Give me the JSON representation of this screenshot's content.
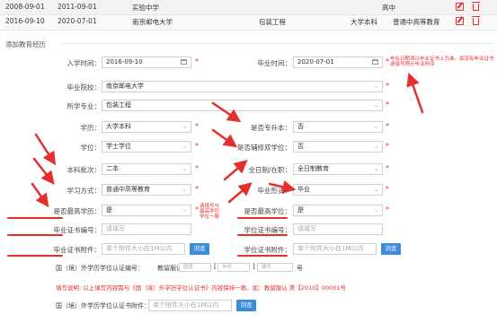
{
  "table": {
    "rows": [
      {
        "start": "2008-09-01",
        "end": "2011-09-01",
        "school": "实验中学",
        "major": "",
        "level": "高中",
        "mode": ""
      },
      {
        "start": "2016-09-10",
        "end": "2020-07-01",
        "school": "南京邮电大学",
        "major": "包装工程",
        "level": "大学本科",
        "mode": "普通中高等教育"
      }
    ]
  },
  "section_title": "添加教育经历",
  "form": {
    "enroll_label": "入学时间：",
    "enroll_value": "2016-09-10",
    "graduate_label": "毕业时间：",
    "graduate_value": "2020-07-01",
    "school_label": "毕业院校：",
    "school_value": "南京邮电大学",
    "major_label": "所学专业：",
    "major_value": "包装工程",
    "edu_label": "学历：",
    "edu_value": "大学本科",
    "upgrade_label": "是否专升本：",
    "upgrade_value": "否",
    "degree_label": "学位：",
    "degree_value": "学士学位",
    "double_label": "是否辅修双学位：",
    "double_value": "否",
    "batch_label": "本科批次：",
    "batch_value": "二本",
    "fulltime_label": "全日制/在职：",
    "fulltime_value": "全日制教育",
    "study_label": "学习方式：",
    "study_value": "普通中高等教育",
    "grad_form_label": "毕业形式：",
    "grad_form_value": "毕业",
    "highest_edu_label": "是否最高学历：",
    "highest_edu_value": "是",
    "highest_deg_label": "是否最高学位：",
    "highest_deg_value": "是",
    "diploma_no_label": "毕业证书编号：",
    "diploma_no_placeholder": "请填写",
    "degree_no_label": "学位证书编号：",
    "degree_no_placeholder": "请填写",
    "diploma_att_label": "毕业证书附件：",
    "diploma_att_placeholder": "单个附件大小在1M以内",
    "degree_att_label": "学位证书附件：",
    "degree_att_placeholder": "单个附件大小在1M以内",
    "browse_label": "浏览",
    "foreign_no_label": "国（境）外学历学位认证编号：",
    "foreign_prefix": "教留服认",
    "foreign_country_ph": "国家",
    "foreign_year_ph": "年份",
    "foreign_num_ph": "编号",
    "foreign_suffix": "号",
    "foreign_bracket_open": "[",
    "foreign_bracket_close": "]",
    "fill_note": "填写说明: 以上填写内容需与《国（境）外学历学位认证书》内容保持一致。如：教留服认 美【2010】00001号",
    "foreign_att_label": "国（境）外学历学位认证书附件：",
    "foreign_att_placeholder": "单个附件大小在1M以内"
  },
  "annotations": {
    "graduate_note": "毕业日期须以毕业证书上为准，如没有毕业证书请填写预计毕业时间",
    "edu_note": "请填写与最高学历学位一致"
  },
  "colors": {
    "accent": "#e52e2e",
    "button": "#3b8cd9",
    "row_alt": "#f3f3f3"
  }
}
